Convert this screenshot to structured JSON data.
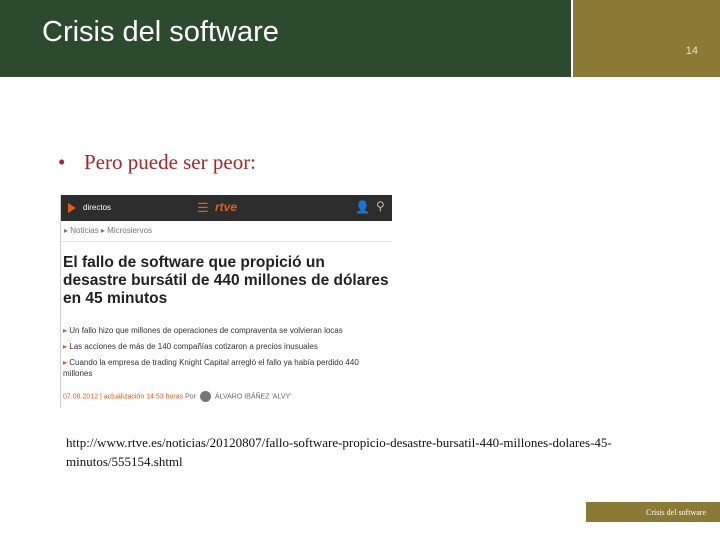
{
  "slide": {
    "title": "Crisis del software",
    "number": "14",
    "bullet": "Pero puede ser peor:",
    "bullet_marker": "•",
    "url": "http://www.rtve.es/noticias/20120807/fallo-software-propicio-desastre-bursatil-440-millones-dolares-45-minutos/555154.shtml",
    "footer": "Crisis del software"
  },
  "article": {
    "nav": {
      "live_label": "directos",
      "menu_glyph": "☰",
      "logo": "rtve",
      "user_glyph": "👤",
      "search_glyph": "⚲"
    },
    "breadcrumb": "▸ Noticias ▸ Microsiervos",
    "headline": "El fallo de software que propició un desastre bursátil de 440 millones de dólares en 45 minutos",
    "leads": [
      "Un fallo hizo que millones de operaciones de compraventa se volvieran locas",
      "Las acciones de más de 140 compañías cotizaron a precios inusuales",
      "Cuando la empresa de trading Knight Capital arregló el fallo ya había perdido 440 millones"
    ],
    "lead_marker": "▸",
    "byline": {
      "date": "07.08.2012 | actualización 14:53 horas",
      "by": "Por",
      "author": "ÁLVARO IBÁÑEZ 'ALVY'"
    }
  },
  "colors": {
    "header_green": "#2c4a2e",
    "header_gold": "#8a7a35",
    "bullet_red": "#a8262a",
    "rtve_orange": "#e35a1a"
  }
}
